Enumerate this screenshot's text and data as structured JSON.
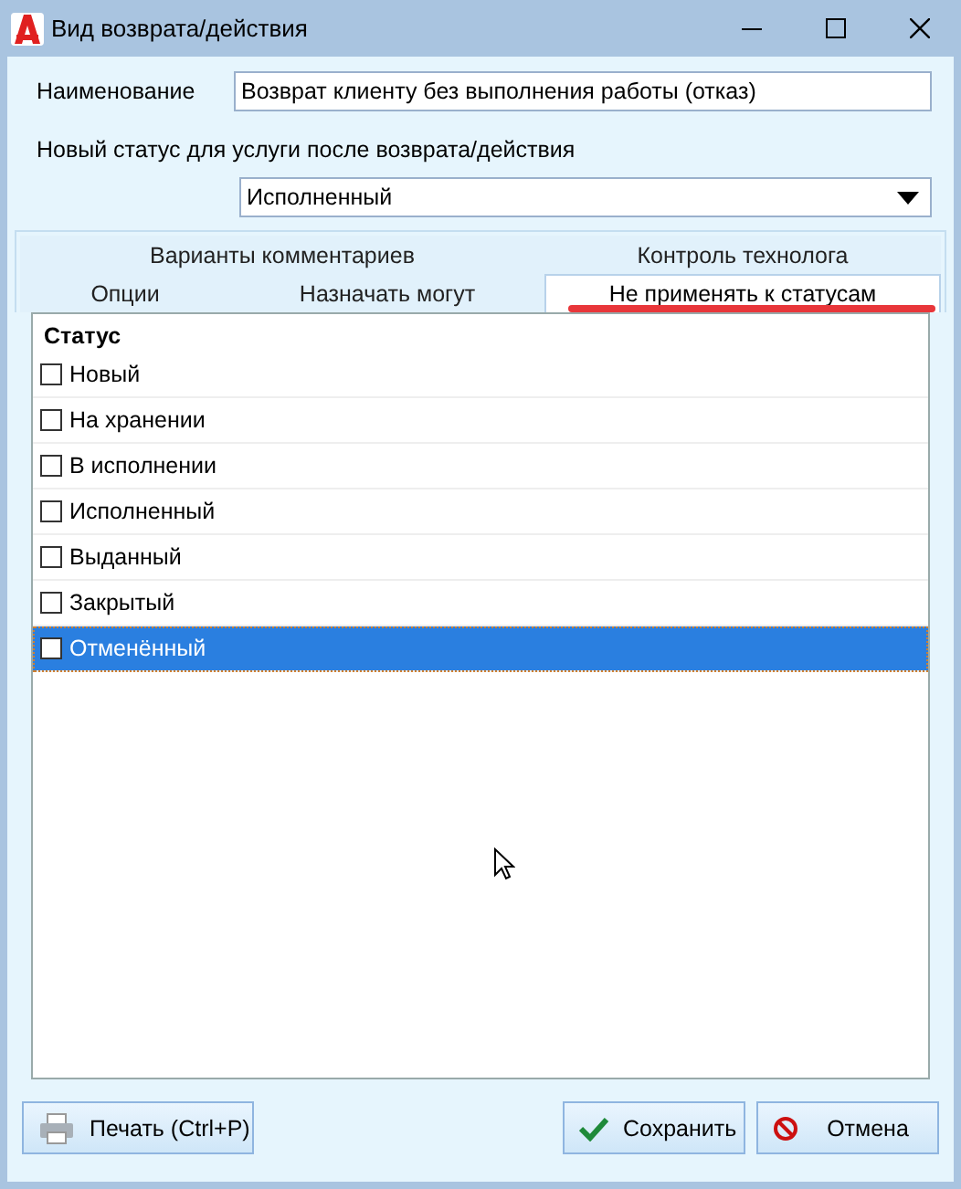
{
  "window": {
    "title": "Вид возврата/действия"
  },
  "name_field": {
    "label": "Наименование",
    "value": "Возврат клиенту без выполнения работы (отказ)"
  },
  "status_field": {
    "label": "Новый статус для услуги после возврата/действия",
    "value": "Исполненный"
  },
  "tab_rows": [
    [
      {
        "label": "Варианты комментариев",
        "selected": false,
        "underlined": false
      },
      {
        "label": "Контроль технолога",
        "selected": false,
        "underlined": false
      }
    ],
    [
      {
        "label": "Опции",
        "selected": false,
        "underlined": false
      },
      {
        "label": "Назначать могут",
        "selected": false,
        "underlined": false
      },
      {
        "label": "Не применять к статусам",
        "selected": true,
        "underlined": true
      }
    ]
  ],
  "list": {
    "header": "Статус",
    "items": [
      {
        "label": "Новый",
        "checked": false,
        "selected": false
      },
      {
        "label": "На хранении",
        "checked": false,
        "selected": false
      },
      {
        "label": "В исполнении",
        "checked": false,
        "selected": false
      },
      {
        "label": "Исполненный",
        "checked": false,
        "selected": false
      },
      {
        "label": "Выданный",
        "checked": false,
        "selected": false
      },
      {
        "label": "Закрытый",
        "checked": false,
        "selected": false
      },
      {
        "label": "Отменённый",
        "checked": false,
        "selected": true
      }
    ]
  },
  "buttons": [
    {
      "kind": "print",
      "label": "Печать (Ctrl+P)"
    },
    {
      "kind": "save",
      "label": "Сохранить"
    },
    {
      "kind": "cancel",
      "label": "Отмена"
    }
  ]
}
